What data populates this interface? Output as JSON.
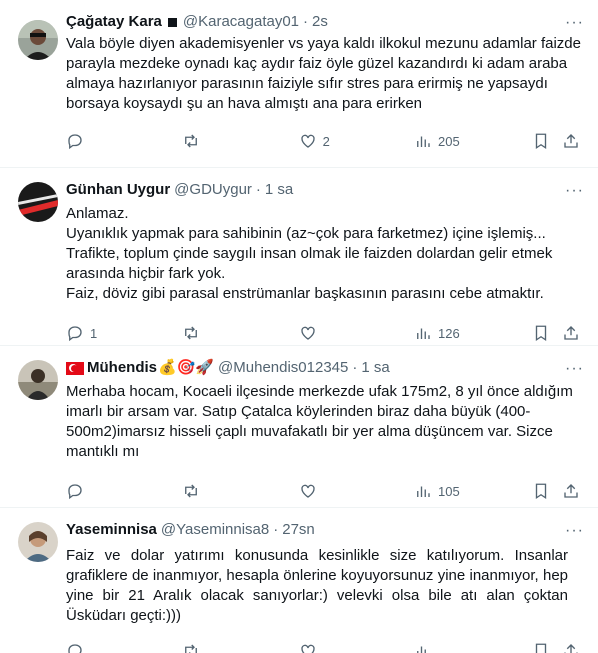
{
  "tweets": [
    {
      "name": "Çağatay Kara",
      "handle": "@Karacagatay01",
      "time": "2s",
      "text": "Vala böyle diyen akademisyenler vs yaya kaldı ilkokul mezunu adamlar faizde parayla mezdeke oynadı kaç aydır faiz öyle güzel kazandırdı ki adam araba almaya hazırlanıyor parasının faiziyle sıfır stres para erirmiş ne yapsaydı borsaya koysaydı şu an hava almıştı ana para erirken",
      "replies": "",
      "likes": "2",
      "views": "205"
    },
    {
      "name": "Günhan Uygur",
      "handle": "@GDUygur",
      "time": "1 sa",
      "lines": [
        "Anlamaz.",
        "Uyanıklık yapmak para sahibinin (az~çok para farketmez) içine işlemiş...",
        "Trafikte, toplum çinde saygılı insan olmak ile faizden dolardan gelir etmek arasında hiçbir fark yok.",
        "Faiz, döviz gibi parasal enstrümanlar başkasının parasını cebe atmaktır."
      ],
      "replies": "1",
      "likes": "",
      "views": "126"
    },
    {
      "name": "Mühendis",
      "emoji": "💰🎯🚀",
      "handle": "@Muhendis012345",
      "time": "1 sa",
      "text": "Merhaba hocam, Kocaeli ilçesinde merkezde ufak 175m2, 8 yıl önce aldığım imarlı bir arsam var. Satıp Çatalca köylerinden biraz daha büyük (400-500m2)imarsız hisseli çaplı muvafakatlı bir yer alma düşüncem var. Sizce mantıklı mı",
      "replies": "",
      "likes": "",
      "views": "105"
    },
    {
      "name": "Yaseminnisa",
      "handle": "@Yaseminnisa8",
      "time": "27sn",
      "text": "Faiz ve dolar yatırımı konusunda kesinlikle size katılıyorum. Insanlar grafiklere de inanmıyor, hesapla önlerine koyuyorsunuz yine inanmıyor, hep yine bir 21 Aralık olacak sanıyorlar:) velevki olsa bile atı alan çoktan Üsküdarı geçti:)))",
      "replies": "",
      "likes": "",
      "views": ""
    }
  ],
  "more_label": "···",
  "separator": "·",
  "icons": [
    "reply-icon",
    "retweet-icon",
    "like-icon",
    "views-icon",
    "bookmark-icon",
    "share-icon",
    "more-icon",
    "verified-square-icon",
    "turkish-flag-icon"
  ]
}
